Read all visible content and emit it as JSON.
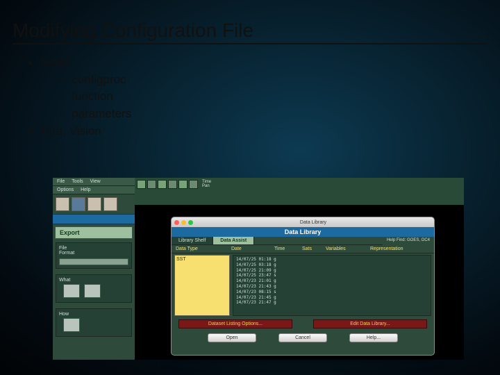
{
  "title": "Modifying Configuration File",
  "bullets": {
    "script": "Script",
    "sub1": "configproc",
    "sub2": "function",
    "sub3": "parameters",
    "teravision": "Tera. Vision"
  },
  "app": {
    "menu": {
      "file": "File",
      "tools": "Tools",
      "view": "View",
      "options": "Options",
      "help": "Help"
    },
    "export_label": "Export",
    "side_file": "File",
    "side_format": "Format",
    "side_what": "What",
    "side_how": "How",
    "ruler_time": "Time",
    "ruler_pan": "Pan"
  },
  "dialog": {
    "window_title": "Data Library",
    "header": "Data Library",
    "tabs": {
      "shelf": "Library Shelf",
      "assist": "Data Assist"
    },
    "hint": "Help Find: GOES, OC4",
    "cols": {
      "type": "Data Type",
      "date": "Date",
      "time": "Time",
      "sats": "Sats",
      "vars": "Variables",
      "rep": "Representation"
    },
    "selected_type": "SST",
    "rows": [
      "14/07/25 01:18 g",
      "14/07/25 03:18 g",
      "14/07/25 21:09 g",
      "14/07/25 23:47 s",
      "14/07/23 21:01 g",
      "14/07/23 21:43 g",
      "14/07/23 08:15 s",
      "14/07/23 21:45 g",
      "14/07/23 21:47 g"
    ],
    "opt_left": "Dataset Listing Options...",
    "opt_right": "Edit Data Library...",
    "btn_open": "Open",
    "btn_cancel": "Cancel",
    "btn_help": "Help..."
  }
}
